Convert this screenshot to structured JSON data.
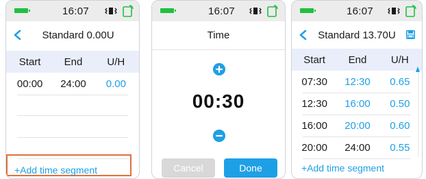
{
  "status_bar": {
    "time": "16:07",
    "battery_color": "#20c040",
    "icons": [
      "battery-icon",
      "vibrate-icon",
      "signal-icon"
    ]
  },
  "screen1": {
    "title": "Standard 0.00U",
    "headers": [
      "Start",
      "End",
      "U/H"
    ],
    "rows": [
      {
        "start": "00:00",
        "end": "24:00",
        "rate": "0.00"
      }
    ],
    "add_label": "+Add time segment",
    "highlight_color": "#e0703a"
  },
  "screen2": {
    "title": "Time",
    "time_value": "00:30",
    "cancel_label": "Cancel",
    "done_label": "Done"
  },
  "screen3": {
    "title": "Standard 13.70U",
    "headers": [
      "Start",
      "End",
      "U/H"
    ],
    "rows": [
      {
        "start": "07:30",
        "end": "12:30",
        "rate": "0.65"
      },
      {
        "start": "12:30",
        "end": "16:00",
        "rate": "0.50"
      },
      {
        "start": "16:00",
        "end": "20:00",
        "rate": "0.60"
      },
      {
        "start": "20:00",
        "end": "24:00",
        "rate": "0.55"
      }
    ],
    "add_label": "+Add time segment"
  },
  "colors": {
    "accent": "#1ea0e6",
    "header_bg": "#e9eefa",
    "status_bg": "#ececec"
  }
}
